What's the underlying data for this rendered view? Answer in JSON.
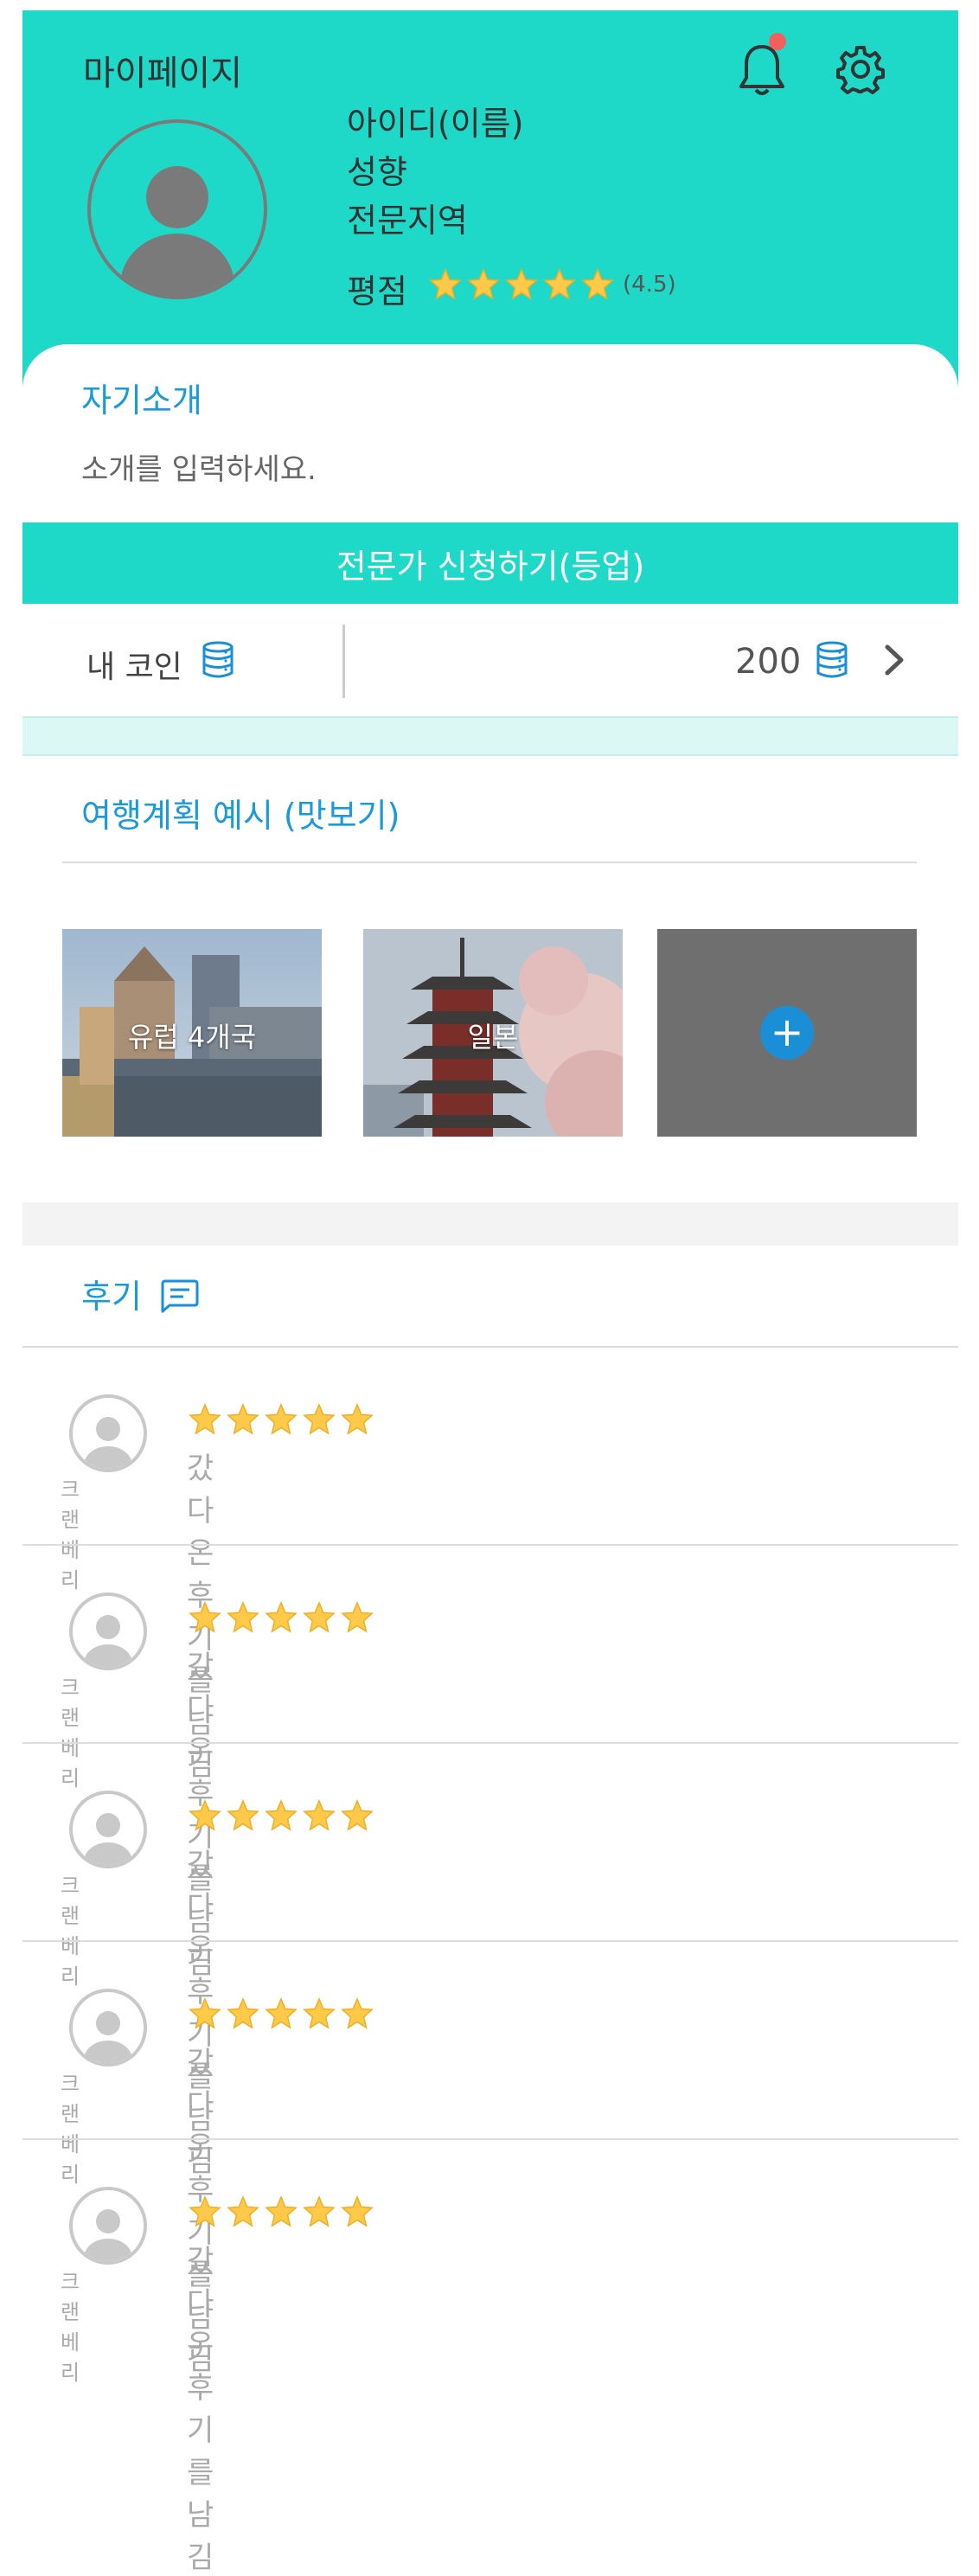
{
  "header": {
    "title": "마이페이지",
    "id_name": "아이디(이름)",
    "tendency": "성향",
    "region": "전문지역",
    "rating_label": "평점",
    "rating_value": "(4.5)",
    "rating_stars": 5,
    "has_notification": true
  },
  "intro": {
    "label": "자기소개",
    "placeholder_text": "소개를 입력하세요."
  },
  "apply_button": "전문가 신청하기(등업)",
  "coin": {
    "label": "내 코인",
    "value": "200"
  },
  "plans": {
    "label": "여행계획 예시 (맛보기)",
    "items": [
      {
        "caption": "유럽 4개국"
      },
      {
        "caption": "일본"
      }
    ]
  },
  "reviews": {
    "label": "후기",
    "items": [
      {
        "name": "크랜베리",
        "text": "갔다온 후기를 남김",
        "stars": 5
      },
      {
        "name": "크랜베리",
        "text": "갔다온 후기를 남김",
        "stars": 5
      },
      {
        "name": "크랜베리",
        "text": "갔다온 후기를 남김",
        "stars": 5
      },
      {
        "name": "크랜베리",
        "text": "갔다온 후기를 남김",
        "stars": 5
      },
      {
        "name": "크랜베리",
        "text": "갔다온 후기를 남김",
        "stars": 5
      }
    ]
  },
  "colors": {
    "brand": "#1fd9c8",
    "accent_text": "#1a9ad6",
    "star": "#ffc94a",
    "notification": "#f25f5c"
  },
  "icons": [
    "bell-icon",
    "gear-icon",
    "database-icon",
    "chevron-right-icon",
    "plus-icon",
    "chat-icon",
    "star-icon",
    "avatar-icon"
  ]
}
